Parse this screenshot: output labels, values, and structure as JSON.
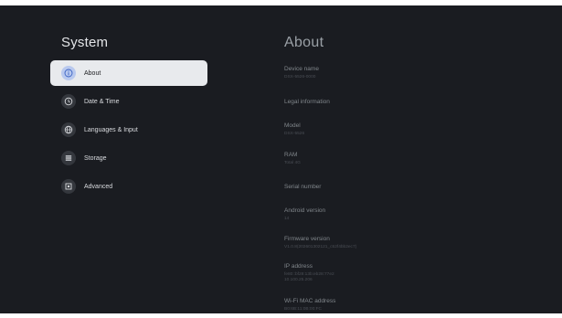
{
  "left": {
    "title": "System",
    "items": [
      {
        "label": "About",
        "icon": "info-icon",
        "selected": true
      },
      {
        "label": "Date & Time",
        "icon": "clock-icon",
        "selected": false
      },
      {
        "label": "Languages & Input",
        "icon": "globe-icon",
        "selected": false
      },
      {
        "label": "Storage",
        "icon": "storage-icon",
        "selected": false
      },
      {
        "label": "Advanced",
        "icon": "advanced-icon",
        "selected": false
      }
    ]
  },
  "right": {
    "title": "About",
    "entries": [
      {
        "label": "Device name",
        "value": "DSX-5526-0000"
      },
      {
        "label": "Legal information",
        "value": ""
      },
      {
        "label": "Model",
        "value": "DSX-5526"
      },
      {
        "label": "RAM",
        "value": "Total 4G"
      },
      {
        "label": "Serial number",
        "value": ""
      },
      {
        "label": "Android version",
        "value": "14"
      },
      {
        "label": "Firmware version",
        "value": "V1.0.8(202601302121_c52f4bb2ec7)"
      },
      {
        "label": "IP address",
        "value": "fe80::bf28:13b:eb28:77e2",
        "value2": "10.100.25.206"
      },
      {
        "label": "Wi-Fi MAC address",
        "value": "B0:6B:11:0B:00:FC"
      }
    ]
  },
  "colors": {
    "background": "#1a1c21",
    "selected_bg": "#e8eaed",
    "selected_icon_bg": "#b9c9ee"
  }
}
